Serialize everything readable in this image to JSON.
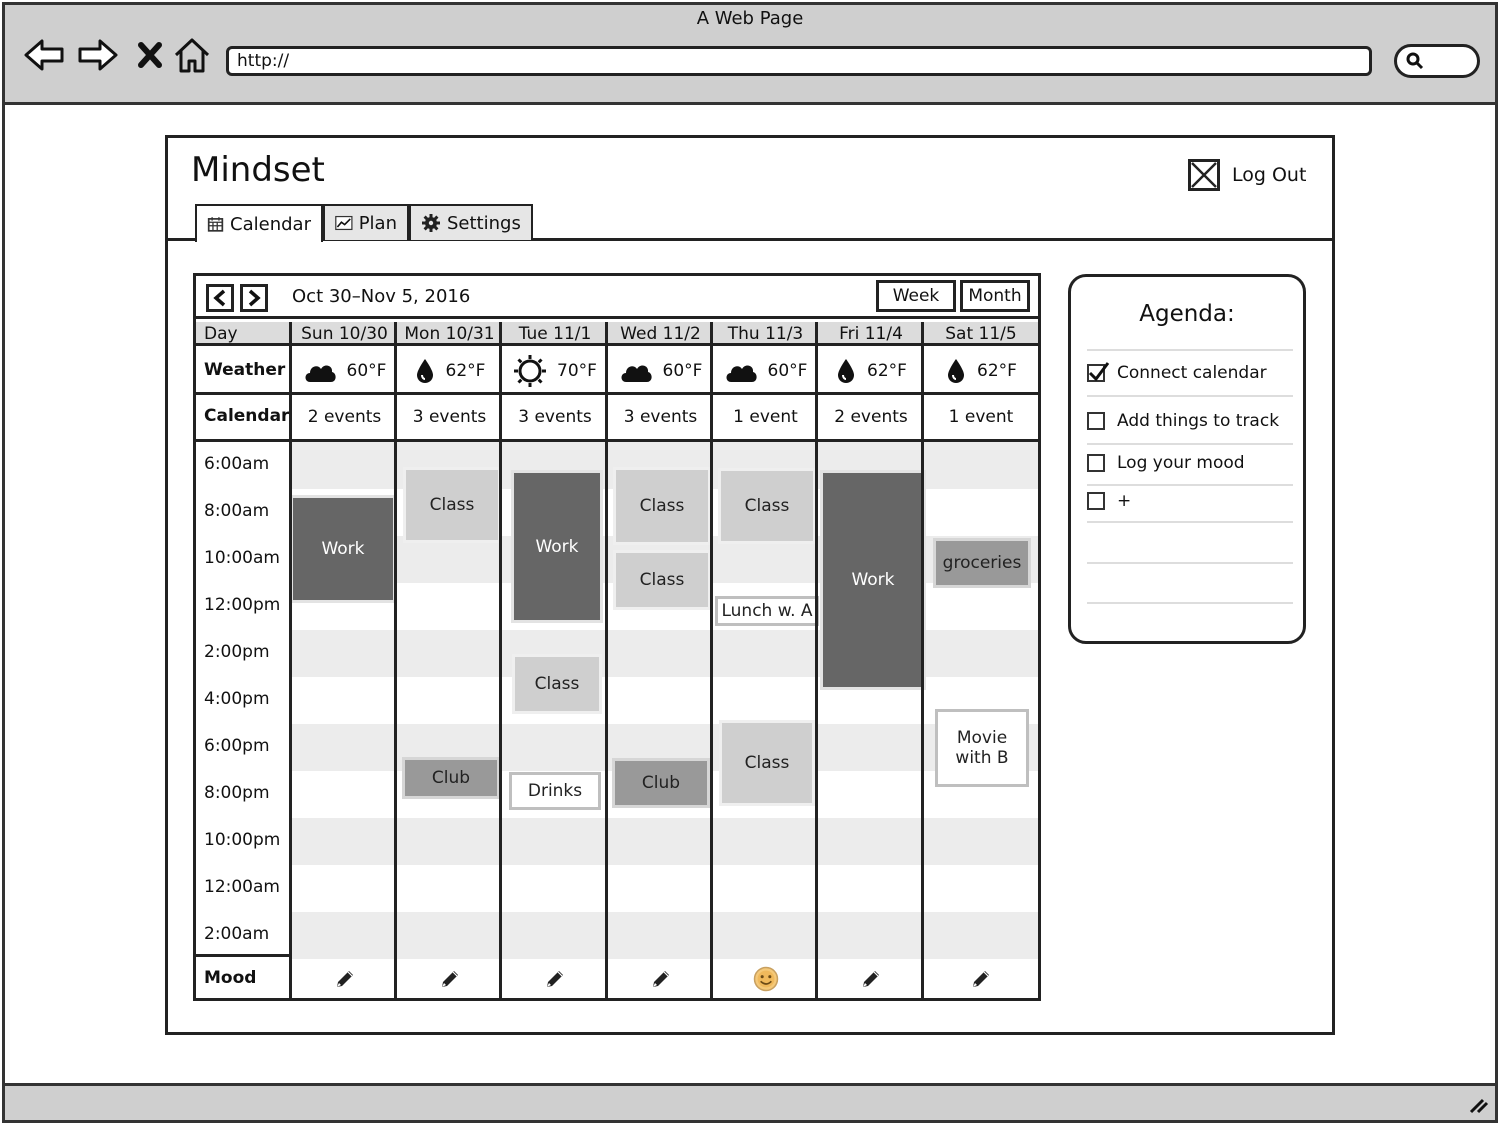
{
  "browser": {
    "window_title": "A Web Page",
    "url": "http://"
  },
  "app": {
    "title": "Mindset",
    "logout_label": "Log Out",
    "tabs": [
      {
        "label": "Calendar",
        "icon": "calendar-icon",
        "active": true
      },
      {
        "label": "Plan",
        "icon": "chart-icon",
        "active": false
      },
      {
        "label": "Settings",
        "icon": "gear-icon",
        "active": false
      }
    ]
  },
  "calendar": {
    "date_range": "Oct 30–Nov 5, 2016",
    "view_buttons": [
      "Week",
      "Month"
    ],
    "day_label": "Day",
    "weather_label": "Weather",
    "calendar_label": "Calendar",
    "mood_label": "Mood",
    "days": [
      {
        "header": "Sun 10/30",
        "weather_icon": "cloud-icon",
        "temp": "60°F",
        "events_count": "2 events"
      },
      {
        "header": "Mon 10/31",
        "weather_icon": "raindrop-icon",
        "temp": "62°F",
        "events_count": "3 events"
      },
      {
        "header": "Tue 11/1",
        "weather_icon": "sun-icon",
        "temp": "70°F",
        "events_count": "3 events"
      },
      {
        "header": "Wed 11/2",
        "weather_icon": "cloud-icon",
        "temp": "60°F",
        "events_count": "3 events"
      },
      {
        "header": "Thu 11/3",
        "weather_icon": "cloud-icon",
        "temp": "60°F",
        "events_count": "1 event"
      },
      {
        "header": "Fri 11/4",
        "weather_icon": "raindrop-icon",
        "temp": "62°F",
        "events_count": "2 events"
      },
      {
        "header": "Sat 11/5",
        "weather_icon": "raindrop-icon",
        "temp": "62°F",
        "events_count": "1 event"
      }
    ],
    "times": [
      "6:00am",
      "8:00am",
      "10:00am",
      "12:00pm",
      "2:00pm",
      "4:00pm",
      "6:00pm",
      "8:00pm",
      "10:00pm",
      "12:00am",
      "2:00am"
    ],
    "events": [
      {
        "day": 0,
        "label": "Work",
        "style": "work"
      },
      {
        "day": 1,
        "label": "Class",
        "style": "class"
      },
      {
        "day": 1,
        "label": "Club",
        "style": "mid"
      },
      {
        "day": 2,
        "label": "Work",
        "style": "work"
      },
      {
        "day": 2,
        "label": "Class",
        "style": "class"
      },
      {
        "day": 2,
        "label": "Drinks",
        "style": "white"
      },
      {
        "day": 3,
        "label": "Class",
        "style": "class"
      },
      {
        "day": 3,
        "label": "Class",
        "style": "class"
      },
      {
        "day": 3,
        "label": "Club",
        "style": "mid"
      },
      {
        "day": 4,
        "label": "Class",
        "style": "class"
      },
      {
        "day": 4,
        "label": "Lunch w. A",
        "style": "white"
      },
      {
        "day": 4,
        "label": "Class",
        "style": "class"
      },
      {
        "day": 5,
        "label": "Work",
        "style": "work"
      },
      {
        "day": 6,
        "label": "groceries",
        "style": "mid"
      },
      {
        "day": 6,
        "label": "Movie with B",
        "style": "white"
      }
    ],
    "moods": [
      "pencil-icon",
      "pencil-icon",
      "pencil-icon",
      "pencil-icon",
      "smiley-icon",
      "pencil-icon",
      "pencil-icon"
    ]
  },
  "agenda": {
    "title": "Agenda:",
    "items": [
      {
        "label": "Connect calendar",
        "checked": true
      },
      {
        "label": "Add things to track",
        "checked": false
      },
      {
        "label": "Log your mood",
        "checked": false
      },
      {
        "label": "+",
        "checked": false
      }
    ]
  }
}
